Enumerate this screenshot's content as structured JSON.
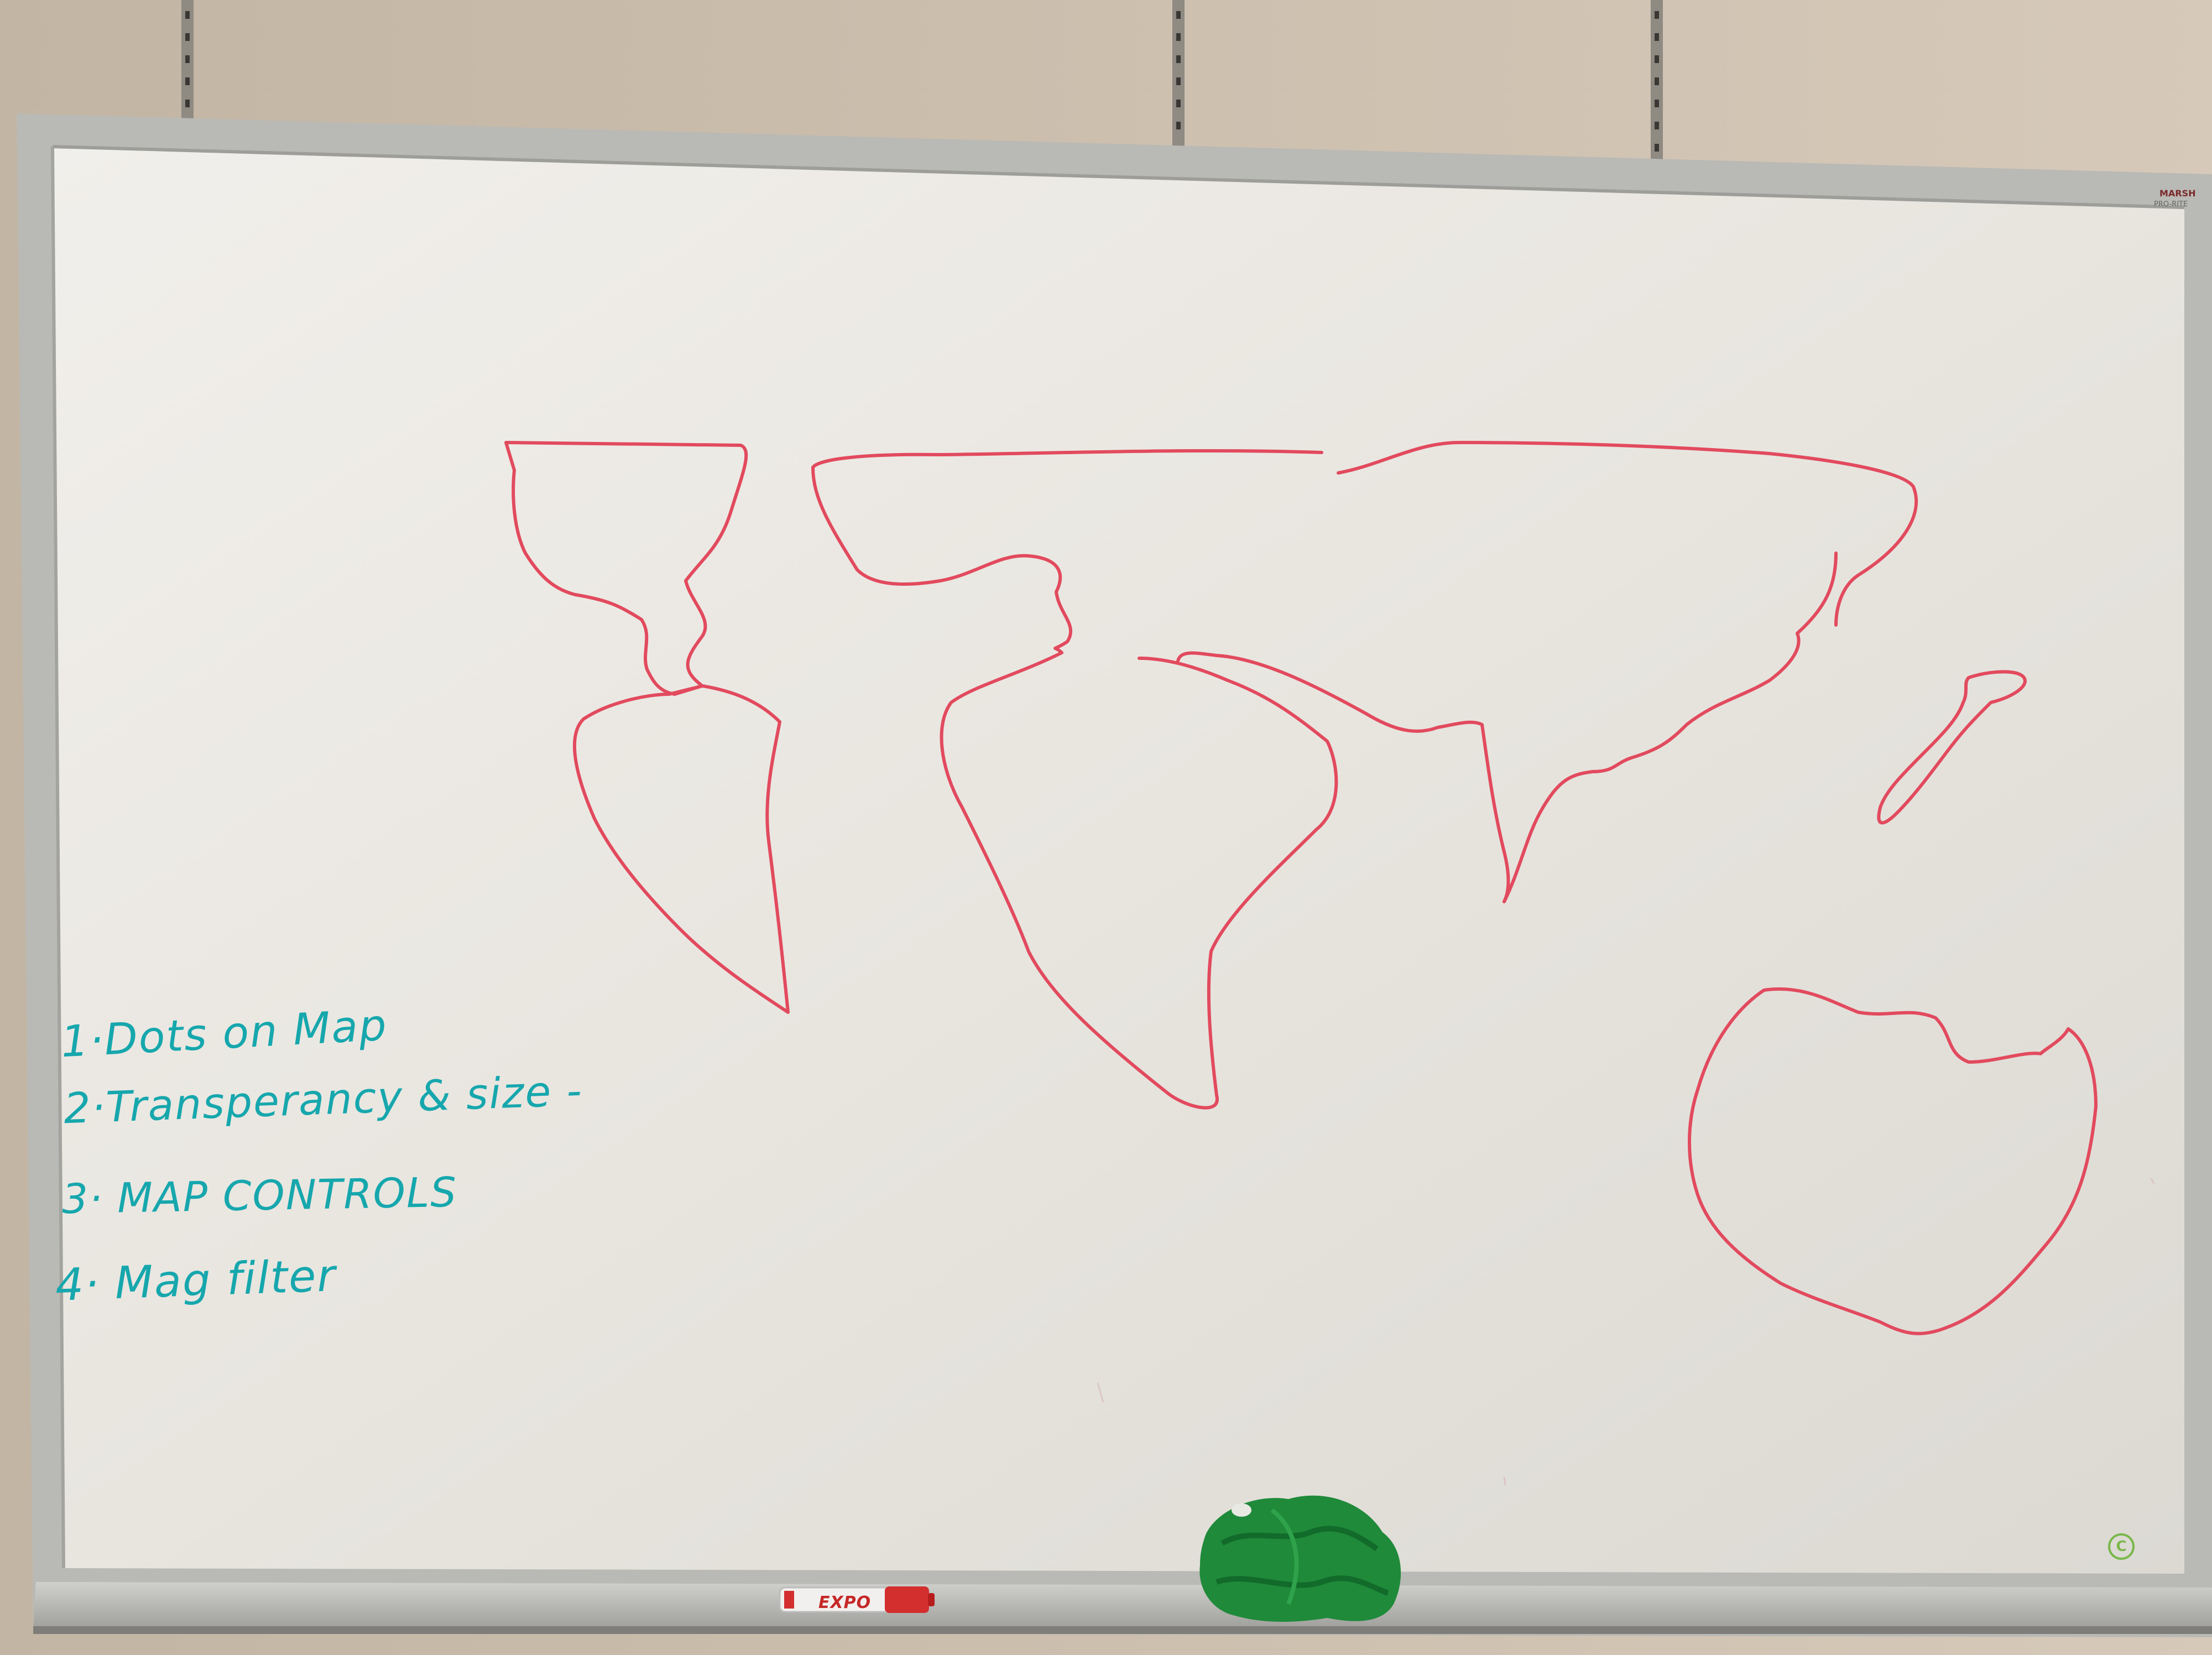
{
  "whiteboard": {
    "brand_name": "MARSH",
    "model_name": "PRO-RITE",
    "eco_mark": "C"
  },
  "notes": [
    "1·Dots on Map",
    "2·Transperancy & size -",
    "3· MAP CONTROLS",
    "4· Mag filter"
  ],
  "marker": {
    "label": "EXPO",
    "color": "#d32f2f"
  },
  "colors": {
    "wall": "#cdbfae",
    "board": "#ebe8e2",
    "frame": "#b9b9b5",
    "continent_ink": "#e24a5e",
    "note_ink": "#16a7ad",
    "eraser_cloth": "#1f8a3a"
  },
  "objects": {
    "eraser": "green-microfiber-cloth",
    "drawing": "world-map-outline"
  }
}
